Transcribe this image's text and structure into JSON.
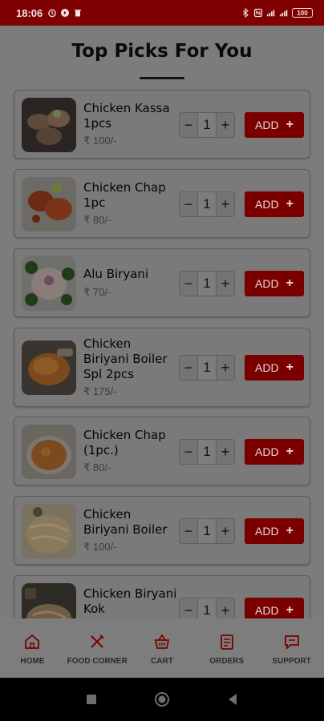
{
  "status": {
    "time": "18:06",
    "battery": "100"
  },
  "page": {
    "title": "Top Picks For You"
  },
  "items": [
    {
      "name": "Chicken Kassa 1pcs",
      "price": "₹ 100/-",
      "qty": "1",
      "add_label": "ADD",
      "image": "grilled-chicken-pieces"
    },
    {
      "name": "Chicken Chap 1pc",
      "price": "₹ 80/-",
      "qty": "1",
      "add_label": "ADD",
      "image": "chicken-chap-curry"
    },
    {
      "name": "Alu Biryani",
      "price": "₹ 70/-",
      "qty": "1",
      "add_label": "ADD",
      "image": "alu-biryani-plate"
    },
    {
      "name": "Chicken Biriyani Boiler Spl 2pcs",
      "price": "₹ 175/-",
      "qty": "1",
      "add_label": "ADD",
      "image": "roasted-chicken-leg"
    },
    {
      "name": "Chicken Chap (1pc.)",
      "price": "₹ 80/-",
      "qty": "1",
      "add_label": "ADD",
      "image": "chicken-chap-bowl"
    },
    {
      "name": "Chicken Biriyani Boiler",
      "price": "₹ 100/-",
      "qty": "1",
      "add_label": "ADD",
      "image": "biryani-rice"
    },
    {
      "name": "Chicken Biryani Kok",
      "price": "",
      "qty": "1",
      "add_label": "ADD",
      "image": "biryani-handi"
    }
  ],
  "nav": [
    {
      "label": "HOME",
      "icon": "home-icon"
    },
    {
      "label": "FOOD CORNER",
      "icon": "fork-knife-icon"
    },
    {
      "label": "CART",
      "icon": "basket-icon"
    },
    {
      "label": "ORDERS",
      "icon": "orders-icon"
    },
    {
      "label": "SUPPORT",
      "icon": "chat-icon"
    }
  ],
  "colors": {
    "brand": "#7a0000",
    "status_bar": "#7e0000"
  }
}
